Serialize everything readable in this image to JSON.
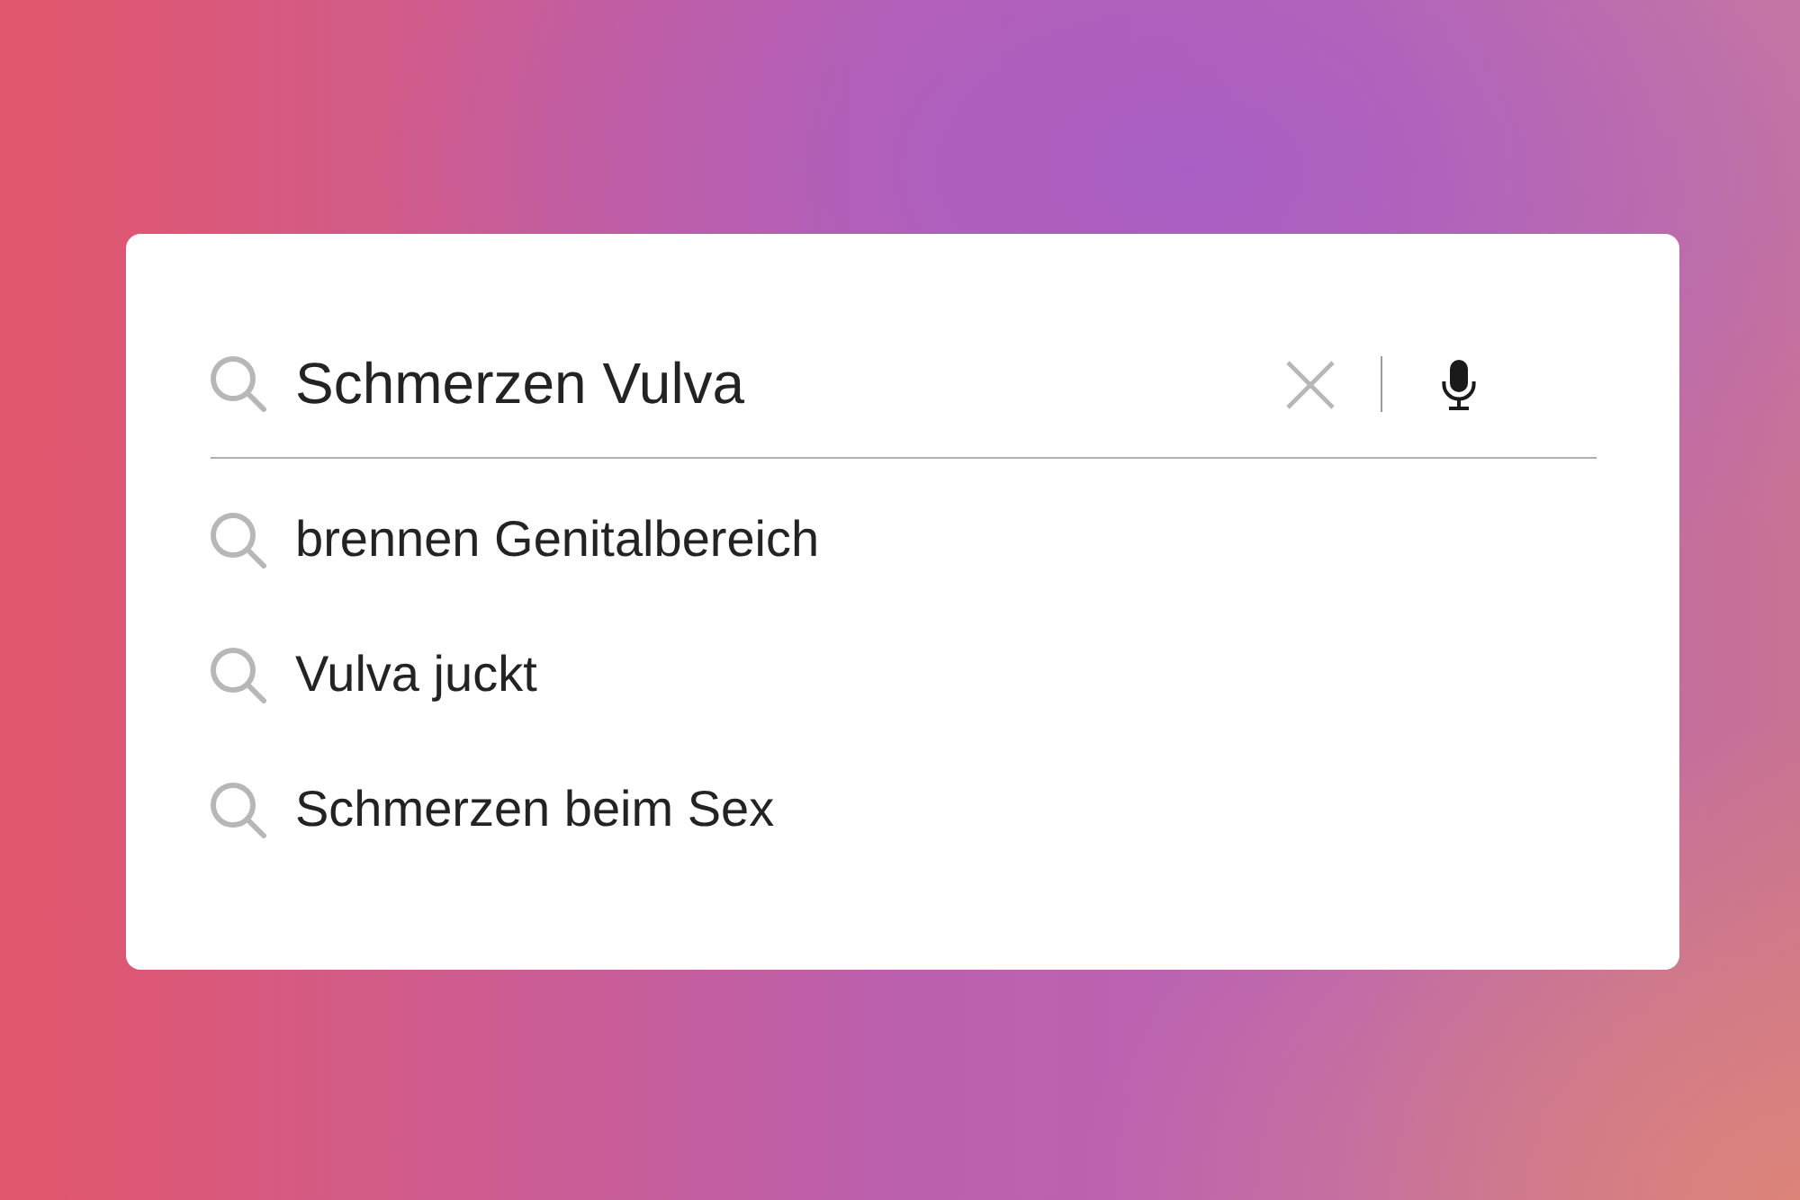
{
  "search": {
    "value": "Schmerzen Vulva"
  },
  "suggestions": [
    {
      "text": "brennen Genitalbereich"
    },
    {
      "text": "Vulva juckt"
    },
    {
      "text": "Schmerzen beim Sex"
    }
  ]
}
